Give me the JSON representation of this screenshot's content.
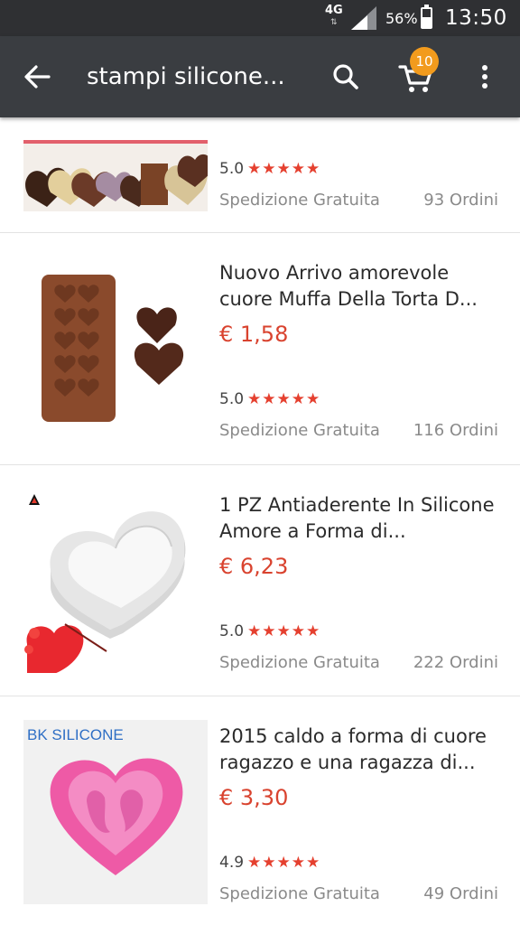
{
  "status_bar": {
    "network": "4G",
    "network_sub": "⇅",
    "battery_percent": "56%",
    "battery_level": 0.56,
    "time": "13:50"
  },
  "app_bar": {
    "back_icon": "arrow-back-icon",
    "title": "stampi silicone...",
    "search_icon": "search-icon",
    "cart_icon": "shopping-cart-icon",
    "cart_count": "10",
    "more_icon": "more-vert-icon"
  },
  "colors": {
    "status_bar": "#2f3033",
    "app_bar": "#3a3d41",
    "price": "#d9432f",
    "stars": "#e5402f",
    "badge": "#f29b1d"
  },
  "products": [
    {
      "title": "",
      "price": "",
      "rating": "5.0",
      "stars": "★★★★★",
      "shipping": "Spedizione Gratuita",
      "orders": "93 Ordini"
    },
    {
      "title": "Nuovo Arrivo amorevole cuore Muffa Della Torta D...",
      "price": "€ 1,58",
      "rating": "5.0",
      "stars": "★★★★★",
      "shipping": "Spedizione Gratuita",
      "orders": "116 Ordini"
    },
    {
      "title": "1 PZ Antiaderente In Silicone Amore a Forma di...",
      "price": "€ 6,23",
      "rating": "5.0",
      "stars": "★★★★★",
      "shipping": "Spedizione Gratuita",
      "orders": "222 Ordini"
    },
    {
      "title": "2015 caldo a forma di cuore ragazzo e una ragazza di...",
      "price": "€ 3,30",
      "rating": "4.9",
      "stars": "★★★★★",
      "shipping": "Spedizione Gratuita",
      "orders": "49 Ordini",
      "image_brand": "BK SILICONE"
    }
  ]
}
